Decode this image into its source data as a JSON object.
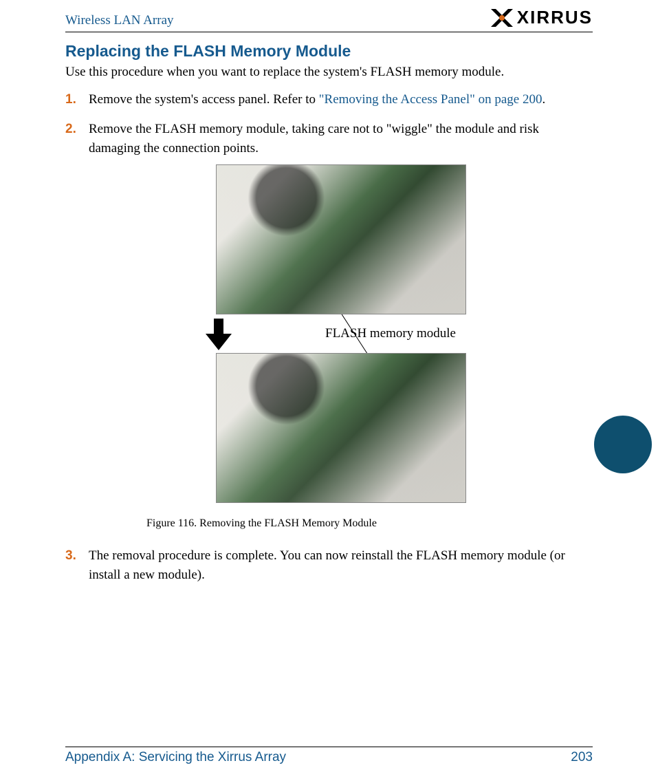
{
  "header": {
    "running_title": "Wireless LAN Array",
    "logo_text": "XIRRUS"
  },
  "section": {
    "title": "Replacing the FLASH Memory Module",
    "intro": "Use this procedure when you want to replace the system's FLASH memory module."
  },
  "steps": [
    {
      "num": "1.",
      "text_before_link": "Remove the system's access panel. Refer to ",
      "link_text": "\"Removing the Access Panel\" on page 200",
      "text_after_link": "."
    },
    {
      "num": "2.",
      "text": "Remove the FLASH memory module, taking care not to \"wiggle\" the module and risk damaging the connection points."
    },
    {
      "num": "3.",
      "text": "The removal procedure is complete. You can now reinstall the FLASH memory module (or install a new module)."
    }
  ],
  "figure": {
    "callout": "FLASH memory module",
    "caption": "Figure 116. Removing the FLASH Memory Module"
  },
  "footer": {
    "appendix": "Appendix A: Servicing the Xirrus Array",
    "page": "203"
  }
}
